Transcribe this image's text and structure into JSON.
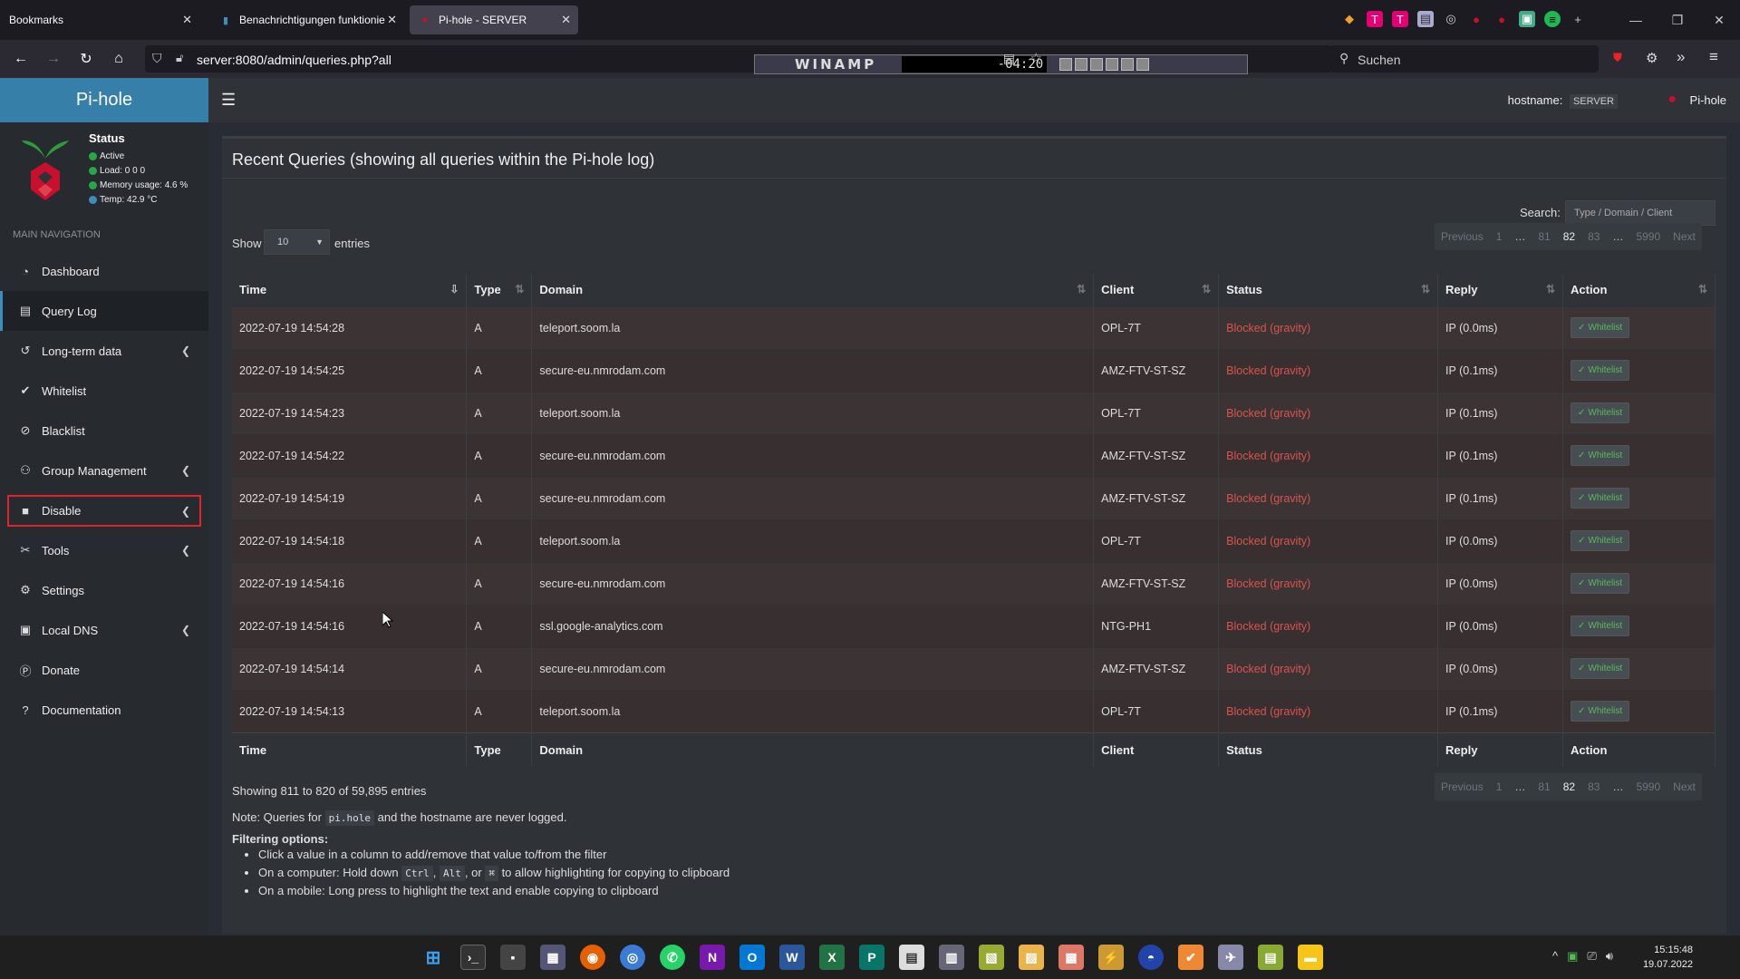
{
  "browser": {
    "tabs": [
      {
        "label": "Bookmarks"
      },
      {
        "label": "Benachrichtigungen funktionie"
      },
      {
        "label": "Pi-hole - SERVER"
      }
    ],
    "url": "server:8080/admin/queries.php?all",
    "winamp": {
      "logo": "WINAMP",
      "time": "-04:20"
    },
    "search_placeholder": "Suchen"
  },
  "app": {
    "logo": "Pi-hole",
    "hostname_label": "hostname:",
    "hostname_value": "SERVER",
    "brand_right": "Pi-hole",
    "status": {
      "title": "Status",
      "active": "Active",
      "load": "Load:  0  0  0",
      "memory": "Memory usage:  4.6 %",
      "temp": "Temp: 42.9 °C"
    },
    "nav_header": "MAIN NAVIGATION",
    "menu": [
      {
        "label": "Dashboard",
        "icon": "dashboard-icon"
      },
      {
        "label": "Query Log",
        "icon": "file-icon"
      },
      {
        "label": "Long-term data",
        "icon": "history-icon"
      },
      {
        "label": "Whitelist",
        "icon": "check-circle-icon"
      },
      {
        "label": "Blacklist",
        "icon": "ban-icon"
      },
      {
        "label": "Group Management",
        "icon": "users-icon"
      },
      {
        "label": "Disable",
        "icon": "stop-icon"
      },
      {
        "label": "Tools",
        "icon": "tools-icon"
      },
      {
        "label": "Settings",
        "icon": "gear-icon"
      },
      {
        "label": "Local DNS",
        "icon": "address-book-icon"
      },
      {
        "label": "Donate",
        "icon": "paypal-icon"
      },
      {
        "label": "Documentation",
        "icon": "question-icon"
      }
    ]
  },
  "queries": {
    "title": "Recent Queries (showing all queries within the Pi-hole log)",
    "search_label": "Search:",
    "search_placeholder": "Type / Domain / Client",
    "show_label": "Show",
    "show_value": "10",
    "entries_label": "entries",
    "pager": [
      "Previous",
      "1",
      "…",
      "81",
      "82",
      "83",
      "…",
      "5990",
      "Next"
    ],
    "pager_current": "82",
    "columns": [
      "Time",
      "Type",
      "Domain",
      "Client",
      "Status",
      "Reply",
      "Action"
    ],
    "rows": [
      {
        "time": "2022-07-19 14:54:28",
        "type": "A",
        "domain": "teleport.soom.la",
        "client": "OPL-7T",
        "status": "Blocked (gravity)",
        "reply": "IP (0.0ms)"
      },
      {
        "time": "2022-07-19 14:54:25",
        "type": "A",
        "domain": "secure-eu.nmrodam.com",
        "client": "AMZ-FTV-ST-SZ",
        "status": "Blocked (gravity)",
        "reply": "IP (0.1ms)"
      },
      {
        "time": "2022-07-19 14:54:23",
        "type": "A",
        "domain": "teleport.soom.la",
        "client": "OPL-7T",
        "status": "Blocked (gravity)",
        "reply": "IP (0.1ms)"
      },
      {
        "time": "2022-07-19 14:54:22",
        "type": "A",
        "domain": "secure-eu.nmrodam.com",
        "client": "AMZ-FTV-ST-SZ",
        "status": "Blocked (gravity)",
        "reply": "IP (0.1ms)"
      },
      {
        "time": "2022-07-19 14:54:19",
        "type": "A",
        "domain": "secure-eu.nmrodam.com",
        "client": "AMZ-FTV-ST-SZ",
        "status": "Blocked (gravity)",
        "reply": "IP (0.1ms)"
      },
      {
        "time": "2022-07-19 14:54:18",
        "type": "A",
        "domain": "teleport.soom.la",
        "client": "OPL-7T",
        "status": "Blocked (gravity)",
        "reply": "IP (0.0ms)"
      },
      {
        "time": "2022-07-19 14:54:16",
        "type": "A",
        "domain": "secure-eu.nmrodam.com",
        "client": "AMZ-FTV-ST-SZ",
        "status": "Blocked (gravity)",
        "reply": "IP (0.0ms)"
      },
      {
        "time": "2022-07-19 14:54:16",
        "type": "A",
        "domain": "ssl.google-analytics.com",
        "client": "NTG-PH1",
        "status": "Blocked (gravity)",
        "reply": "IP (0.0ms)"
      },
      {
        "time": "2022-07-19 14:54:14",
        "type": "A",
        "domain": "secure-eu.nmrodam.com",
        "client": "AMZ-FTV-ST-SZ",
        "status": "Blocked (gravity)",
        "reply": "IP (0.0ms)"
      },
      {
        "time": "2022-07-19 14:54:13",
        "type": "A",
        "domain": "teleport.soom.la",
        "client": "OPL-7T",
        "status": "Blocked (gravity)",
        "reply": "IP (0.1ms)"
      }
    ],
    "action_label": "Whitelist",
    "showing": "Showing 811 to 820 of 59,895 entries",
    "note_prefix": "Note: Queries for",
    "note_code": "pi.hole",
    "note_suffix": "and the hostname are never logged.",
    "filter_title": "Filtering options:",
    "filter_items": [
      "Click a value in a column to add/remove that value to/from the filter",
      "On a computer: Hold down",
      "On a mobile: Long press to highlight the text and enable copying to clipboard"
    ],
    "filter_keys": [
      "Ctrl",
      "Alt",
      "⌘"
    ],
    "filter_key_sep": ",",
    "filter_key_or": ", or",
    "filter_item2_suffix": "to allow highlighting for copying to clipboard"
  },
  "taskbar": {
    "time": "15:15:48",
    "date": "19.07.2022"
  }
}
